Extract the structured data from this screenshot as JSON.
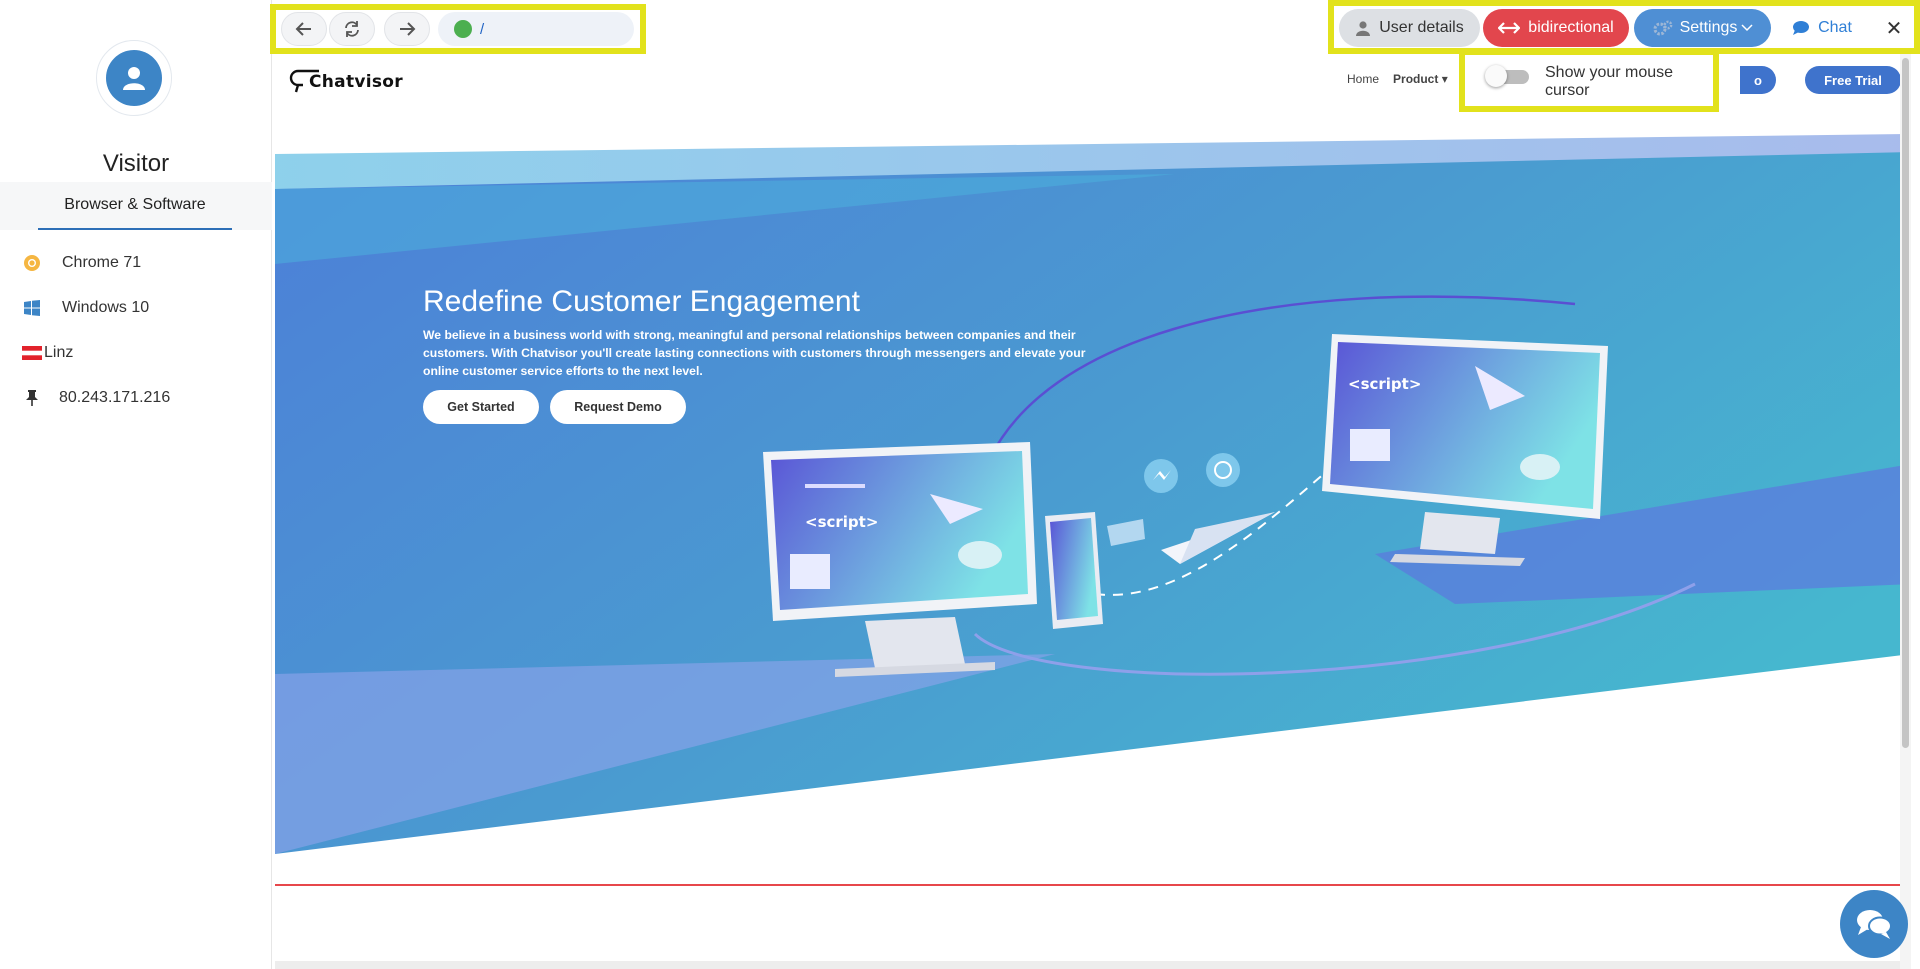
{
  "visitor": {
    "name": "Visitor",
    "tab_label": "Browser & Software",
    "browser": "Chrome 71",
    "os": "Windows 10",
    "city": "Linz",
    "ip": "80.243.171.216"
  },
  "toolbar": {
    "url": "/",
    "user_details_label": "User details",
    "bidirectional_label": "bidirectional",
    "settings_label": "Settings",
    "chat_label": "Chat",
    "close_label": "✕"
  },
  "cursor_toggle": {
    "label": "Show your mouse cursor",
    "enabled": false
  },
  "site": {
    "logo_text": "Chatvisor",
    "nav": {
      "home": "Home",
      "product": "Product"
    },
    "demo_btn_fragment": "o",
    "trial_btn": "Free Trial",
    "hero_title": "Redefine Customer Engagement",
    "hero_desc": "We believe in a business world with strong, meaningful and personal relationships between companies and their customers. With Chatvisor you'll create lasting connections with customers through messengers and elevate your online customer service efforts to the next level.",
    "get_started": "Get Started",
    "request_demo": "Request Demo",
    "monitor_code_text": "<script>"
  },
  "colors": {
    "accent_blue": "#3d85c6",
    "highlight_yellow": "#e2e21c",
    "bidirectional_red": "#e2464d",
    "settings_blue": "#4f8fd4",
    "url_status_green": "#4caf50"
  }
}
